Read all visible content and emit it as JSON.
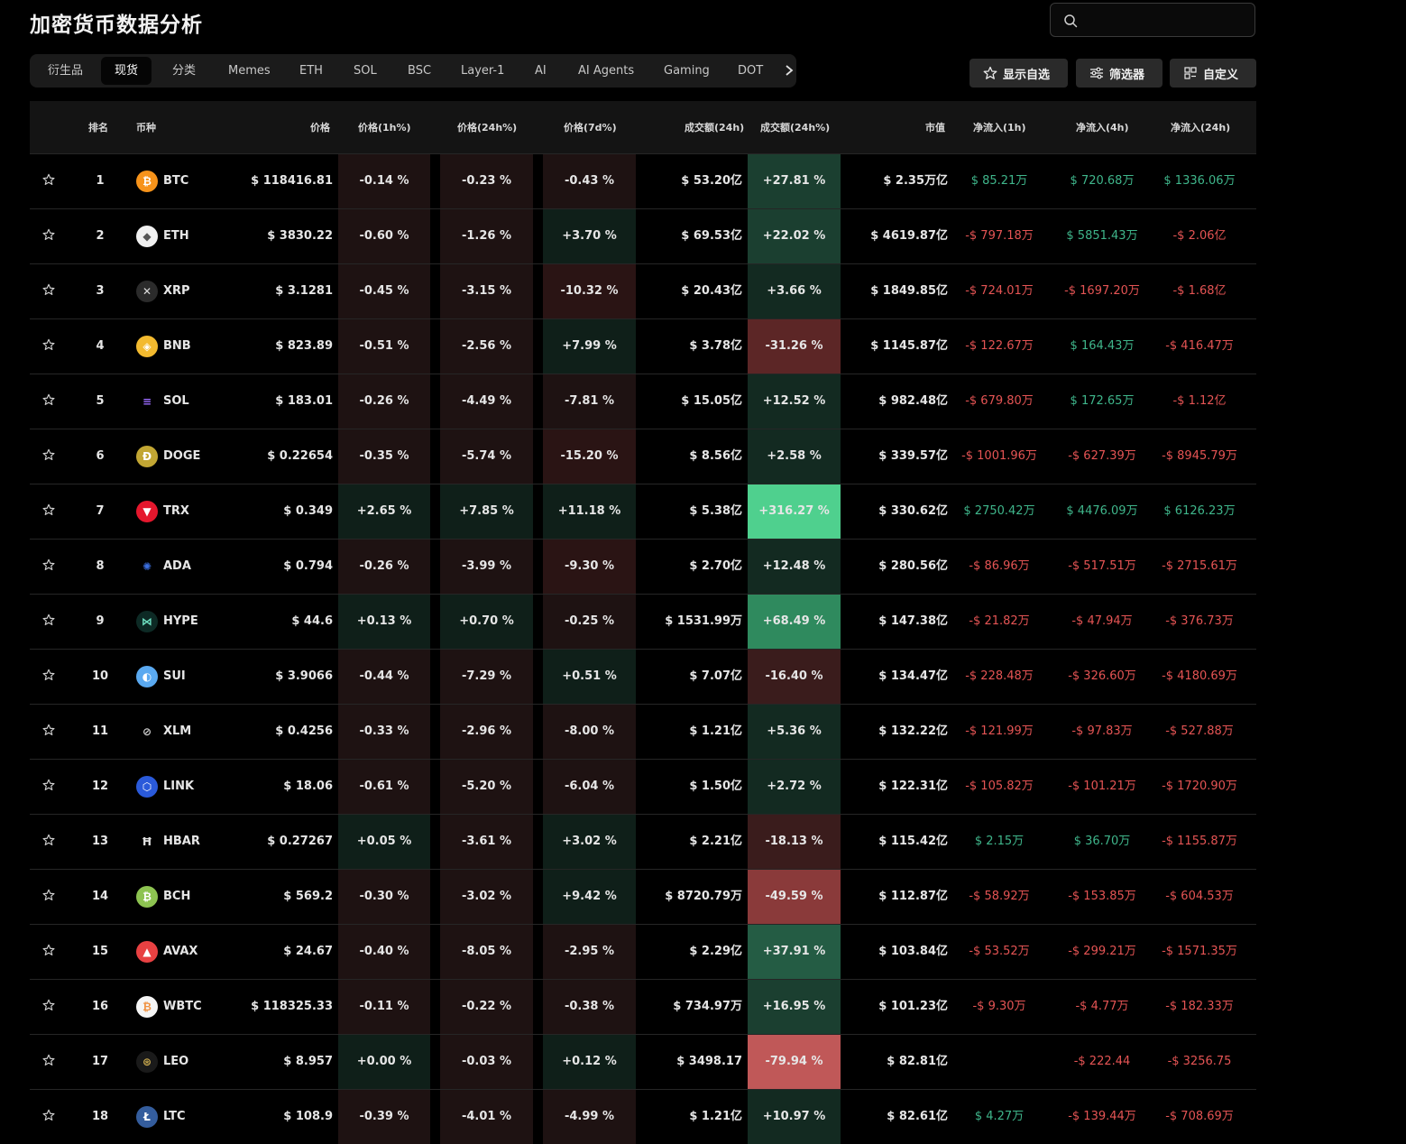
{
  "page": {
    "title": "加密货币数据分析"
  },
  "search": {
    "placeholder": ""
  },
  "tabs": [
    {
      "label": "衍生品",
      "active": false
    },
    {
      "label": "现货",
      "active": true
    },
    {
      "label": "分类",
      "active": false
    },
    {
      "label": "Memes",
      "active": false
    },
    {
      "label": "ETH",
      "active": false
    },
    {
      "label": "SOL",
      "active": false
    },
    {
      "label": "BSC",
      "active": false
    },
    {
      "label": "Layer-1",
      "active": false
    },
    {
      "label": "AI",
      "active": false
    },
    {
      "label": "AI Agents",
      "active": false
    },
    {
      "label": "Gaming",
      "active": false
    },
    {
      "label": "DOT",
      "active": false
    }
  ],
  "actions": {
    "watchlist": "显示自选",
    "filter": "筛选器",
    "customize": "自定义"
  },
  "columns": {
    "rank": "排名",
    "coin": "币种",
    "price": "价格",
    "p1h": "价格(1h%)",
    "p24h": "价格(24h%)",
    "p7d": "价格(7d%)",
    "vol": "成交额(24h)",
    "volpct": "成交额(24h%)",
    "mcap": "市值",
    "f1h": "净流入(1h)",
    "f4h": "净流入(4h)",
    "f24h": "净流入(24h)"
  },
  "colors": {
    "positive": "#3fb68b",
    "negative": "#e55454",
    "pos_cell_weak": "#0f1f19",
    "neg_cell_weak": "#1e1212"
  },
  "rows": [
    {
      "rank": "1",
      "coin": "BTC",
      "icon": "bitcoin-icon",
      "price": "$ 118416.81",
      "p1h": "-0.14 %",
      "p24h": "-0.23 %",
      "p7d": "-0.43 %",
      "vol": "$ 53.20亿",
      "volpct": "+27.81 %",
      "mcap": "$ 2.35万亿",
      "f1h": "$ 85.21万",
      "f4h": "$ 720.68万",
      "f24h": "$ 1336.06万"
    },
    {
      "rank": "2",
      "coin": "ETH",
      "icon": "ethereum-icon",
      "price": "$ 3830.22",
      "p1h": "-0.60 %",
      "p24h": "-1.26 %",
      "p7d": "+3.70 %",
      "vol": "$ 69.53亿",
      "volpct": "+22.02 %",
      "mcap": "$ 4619.87亿",
      "f1h": "-$ 797.18万",
      "f4h": "$ 5851.43万",
      "f24h": "-$ 2.06亿"
    },
    {
      "rank": "3",
      "coin": "XRP",
      "icon": "xrp-icon",
      "price": "$ 3.1281",
      "p1h": "-0.45 %",
      "p24h": "-3.15 %",
      "p7d": "-10.32 %",
      "vol": "$ 20.43亿",
      "volpct": "+3.66 %",
      "mcap": "$ 1849.85亿",
      "f1h": "-$ 724.01万",
      "f4h": "-$ 1697.20万",
      "f24h": "-$ 1.68亿"
    },
    {
      "rank": "4",
      "coin": "BNB",
      "icon": "bnb-icon",
      "price": "$ 823.89",
      "p1h": "-0.51 %",
      "p24h": "-2.56 %",
      "p7d": "+7.99 %",
      "vol": "$ 3.78亿",
      "volpct": "-31.26 %",
      "mcap": "$ 1145.87亿",
      "f1h": "-$ 122.67万",
      "f4h": "$ 164.43万",
      "f24h": "-$ 416.47万"
    },
    {
      "rank": "5",
      "coin": "SOL",
      "icon": "solana-icon",
      "price": "$ 183.01",
      "p1h": "-0.26 %",
      "p24h": "-4.49 %",
      "p7d": "-7.81 %",
      "vol": "$ 15.05亿",
      "volpct": "+12.52 %",
      "mcap": "$ 982.48亿",
      "f1h": "-$ 679.80万",
      "f4h": "$ 172.65万",
      "f24h": "-$ 1.12亿"
    },
    {
      "rank": "6",
      "coin": "DOGE",
      "icon": "dogecoin-icon",
      "price": "$ 0.22654",
      "p1h": "-0.35 %",
      "p24h": "-5.74 %",
      "p7d": "-15.20 %",
      "vol": "$ 8.56亿",
      "volpct": "+2.58 %",
      "mcap": "$ 339.57亿",
      "f1h": "-$ 1001.96万",
      "f4h": "-$ 627.39万",
      "f24h": "-$ 8945.79万"
    },
    {
      "rank": "7",
      "coin": "TRX",
      "icon": "tron-icon",
      "price": "$ 0.349",
      "p1h": "+2.65 %",
      "p24h": "+7.85 %",
      "p7d": "+11.18 %",
      "vol": "$ 5.38亿",
      "volpct": "+316.27 %",
      "mcap": "$ 330.62亿",
      "f1h": "$ 2750.42万",
      "f4h": "$ 4476.09万",
      "f24h": "$ 6126.23万"
    },
    {
      "rank": "8",
      "coin": "ADA",
      "icon": "cardano-icon",
      "price": "$ 0.794",
      "p1h": "-0.26 %",
      "p24h": "-3.99 %",
      "p7d": "-9.30 %",
      "vol": "$ 2.70亿",
      "volpct": "+12.48 %",
      "mcap": "$ 280.56亿",
      "f1h": "-$ 86.96万",
      "f4h": "-$ 517.51万",
      "f24h": "-$ 2715.61万"
    },
    {
      "rank": "9",
      "coin": "HYPE",
      "icon": "hyperliquid-icon",
      "price": "$ 44.6",
      "p1h": "+0.13 %",
      "p24h": "+0.70 %",
      "p7d": "-0.25 %",
      "vol": "$ 1531.99万",
      "volpct": "+68.49 %",
      "mcap": "$ 147.38亿",
      "f1h": "-$ 21.82万",
      "f4h": "-$ 47.94万",
      "f24h": "-$ 376.73万"
    },
    {
      "rank": "10",
      "coin": "SUI",
      "icon": "sui-icon",
      "price": "$ 3.9066",
      "p1h": "-0.44 %",
      "p24h": "-7.29 %",
      "p7d": "+0.51 %",
      "vol": "$ 7.07亿",
      "volpct": "-16.40 %",
      "mcap": "$ 134.47亿",
      "f1h": "-$ 228.48万",
      "f4h": "-$ 326.60万",
      "f24h": "-$ 4180.69万"
    },
    {
      "rank": "11",
      "coin": "XLM",
      "icon": "stellar-icon",
      "price": "$ 0.4256",
      "p1h": "-0.33 %",
      "p24h": "-2.96 %",
      "p7d": "-8.00 %",
      "vol": "$ 1.21亿",
      "volpct": "+5.36 %",
      "mcap": "$ 132.22亿",
      "f1h": "-$ 121.99万",
      "f4h": "-$ 97.83万",
      "f24h": "-$ 527.88万"
    },
    {
      "rank": "12",
      "coin": "LINK",
      "icon": "chainlink-icon",
      "price": "$ 18.06",
      "p1h": "-0.61 %",
      "p24h": "-5.20 %",
      "p7d": "-6.04 %",
      "vol": "$ 1.50亿",
      "volpct": "+2.72 %",
      "mcap": "$ 122.31亿",
      "f1h": "-$ 105.82万",
      "f4h": "-$ 101.21万",
      "f24h": "-$ 1720.90万"
    },
    {
      "rank": "13",
      "coin": "HBAR",
      "icon": "hedera-icon",
      "price": "$ 0.27267",
      "p1h": "+0.05 %",
      "p24h": "-3.61 %",
      "p7d": "+3.02 %",
      "vol": "$ 2.21亿",
      "volpct": "-18.13 %",
      "mcap": "$ 115.42亿",
      "f1h": "$ 2.15万",
      "f4h": "$ 36.70万",
      "f24h": "-$ 1155.87万"
    },
    {
      "rank": "14",
      "coin": "BCH",
      "icon": "bitcoin-cash-icon",
      "price": "$ 569.2",
      "p1h": "-0.30 %",
      "p24h": "-3.02 %",
      "p7d": "+9.42 %",
      "vol": "$ 8720.79万",
      "volpct": "-49.59 %",
      "mcap": "$ 112.87亿",
      "f1h": "-$ 58.92万",
      "f4h": "-$ 153.85万",
      "f24h": "-$ 604.53万"
    },
    {
      "rank": "15",
      "coin": "AVAX",
      "icon": "avalanche-icon",
      "price": "$ 24.67",
      "p1h": "-0.40 %",
      "p24h": "-8.05 %",
      "p7d": "-2.95 %",
      "vol": "$ 2.29亿",
      "volpct": "+37.91 %",
      "mcap": "$ 103.84亿",
      "f1h": "-$ 53.52万",
      "f4h": "-$ 299.21万",
      "f24h": "-$ 1571.35万"
    },
    {
      "rank": "16",
      "coin": "WBTC",
      "icon": "wrapped-bitcoin-icon",
      "price": "$ 118325.33",
      "p1h": "-0.11 %",
      "p24h": "-0.22 %",
      "p7d": "-0.38 %",
      "vol": "$ 734.97万",
      "volpct": "+16.95 %",
      "mcap": "$ 101.23亿",
      "f1h": "-$ 9.30万",
      "f4h": "-$ 4.77万",
      "f24h": "-$ 182.33万"
    },
    {
      "rank": "17",
      "coin": "LEO",
      "icon": "leo-icon",
      "price": "$ 8.957",
      "p1h": "+0.00 %",
      "p24h": "-0.03 %",
      "p7d": "+0.12 %",
      "vol": "$ 3498.17",
      "volpct": "-79.94 %",
      "mcap": "$ 82.81亿",
      "f1h": "",
      "f4h": "-$ 222.44",
      "f24h": "-$ 3256.75"
    },
    {
      "rank": "18",
      "coin": "LTC",
      "icon": "litecoin-icon",
      "price": "$ 108.9",
      "p1h": "-0.39 %",
      "p24h": "-4.01 %",
      "p7d": "-4.99 %",
      "vol": "$ 1.21亿",
      "volpct": "+10.97 %",
      "mcap": "$ 82.61亿",
      "f1h": "$ 4.27万",
      "f4h": "-$ 139.44万",
      "f24h": "-$ 708.69万"
    }
  ]
}
